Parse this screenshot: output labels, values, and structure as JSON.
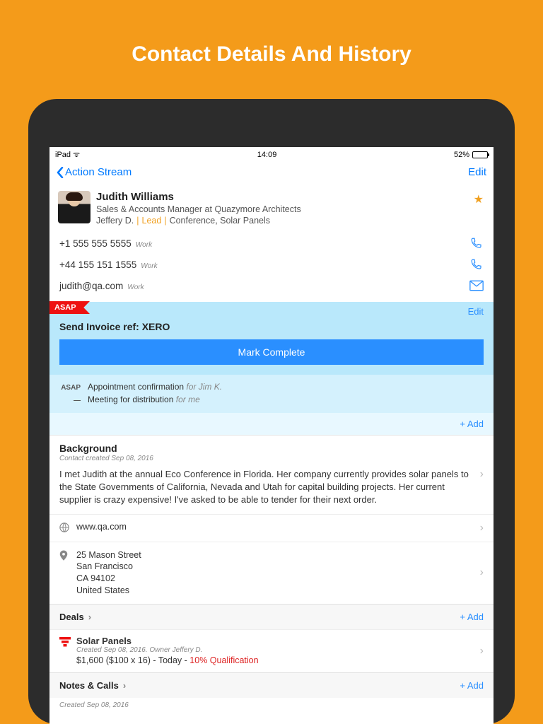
{
  "page_heading": "Contact Details And History",
  "statusbar": {
    "device": "iPad",
    "time": "14:09",
    "battery": "52%"
  },
  "nav": {
    "back": "Action Stream",
    "edit": "Edit"
  },
  "contact": {
    "name": "Judith Williams",
    "title": "Sales & Accounts Manager at Quazymore Architects",
    "owner": "Jeffery  D.",
    "status": "Lead",
    "tags": "Conference, Solar Panels"
  },
  "comms": {
    "phone1": "+1 555 555 5555",
    "phone1_label": "Work",
    "phone2": "+44 155 151 1555",
    "phone2_label": "Work",
    "email": "judith@qa.com",
    "email_label": "Work"
  },
  "task": {
    "badge": "ASAP",
    "edit": "Edit",
    "title": "Send Invoice ref: XERO",
    "complete": "Mark Complete",
    "sub1_tag": "ASAP",
    "sub1_text": "Appointment confirmation",
    "sub1_for": "for Jim K.",
    "sub2_tag": "—",
    "sub2_text": "Meeting for distribution",
    "sub2_for": "for me",
    "add": "+ Add"
  },
  "background": {
    "heading": "Background",
    "created": "Contact created Sep 08, 2016",
    "text": "I met Judith at the annual Eco Conference in Florida. Her company currently provides solar panels to the State Governments of California, Nevada and Utah for capital building projects. Her current supplier is crazy expensive! I've asked to be able to tender for their next order."
  },
  "website": "www.qa.com",
  "address": {
    "line1": "25 Mason Street",
    "line2": "San Francisco",
    "line3": "CA 94102",
    "line4": "United States"
  },
  "deals": {
    "heading": "Deals",
    "add": "+ Add",
    "name": "Solar Panels",
    "meta": "Created Sep 08, 2016. Owner Jeffery  D.",
    "amount": "$1,600 ($100 x 16) - Today - ",
    "qual": "10% Qualification"
  },
  "notes": {
    "heading": "Notes & Calls",
    "add": "+ Add",
    "created": "Created Sep 08, 2016"
  }
}
